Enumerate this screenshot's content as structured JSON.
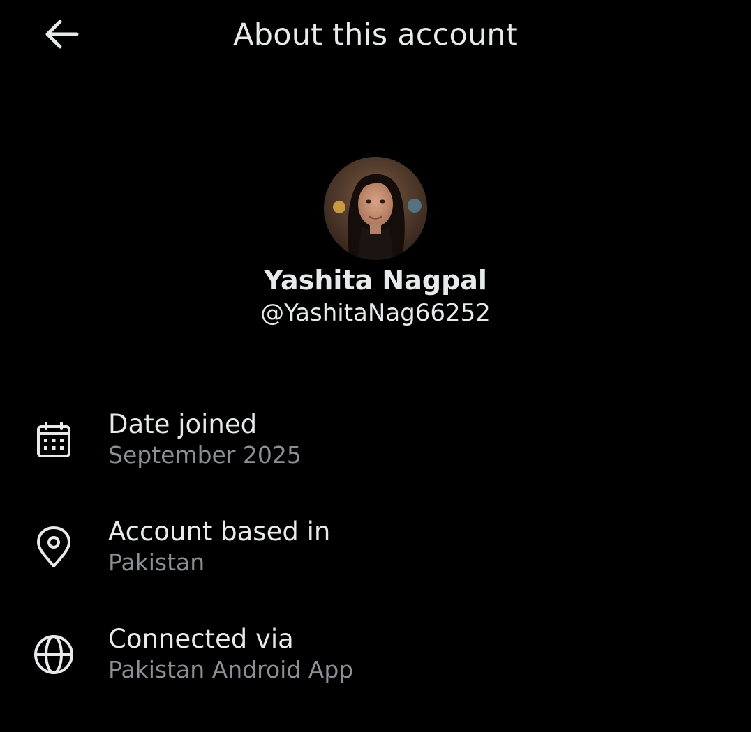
{
  "header": {
    "title": "About this account",
    "back_icon": "arrow-left-icon"
  },
  "profile": {
    "display_name": "Yashita Nagpal",
    "handle": "@YashitaNag66252",
    "avatar_icon": "profile-photo"
  },
  "details": [
    {
      "icon": "calendar-icon",
      "label": "Date joined",
      "value": "September 2025"
    },
    {
      "icon": "location-pin-icon",
      "label": "Account based in",
      "value": "Pakistan"
    },
    {
      "icon": "globe-icon",
      "label": "Connected via",
      "value": "Pakistan Android App"
    }
  ],
  "colors": {
    "background": "#000000",
    "primary_text": "#e7e9ea",
    "secondary_text": "#8b9096"
  }
}
